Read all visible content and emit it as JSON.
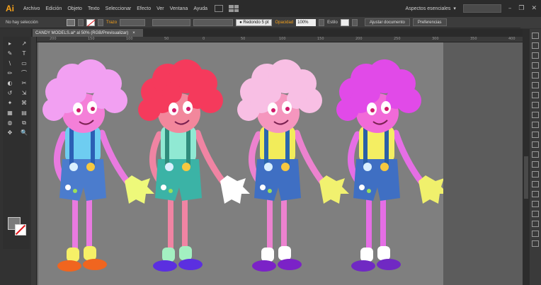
{
  "app": {
    "logo": "Ai",
    "workspace": "Aspectos esenciales",
    "window_controls": [
      "–",
      "❐",
      "✕"
    ]
  },
  "menu": [
    "Archivo",
    "Edición",
    "Objeto",
    "Texto",
    "Seleccionar",
    "Efecto",
    "Ver",
    "Ventana",
    "Ayuda"
  ],
  "control": {
    "selection": "No hay selección",
    "stroke_label": "Trazo",
    "brush": "Redondo 5 pt",
    "opacity_label": "Opacidad",
    "opacity_value": "100%",
    "style_label": "Estilo",
    "doc_setup": "Ajustar documento",
    "preferences": "Preferencias"
  },
  "document": {
    "tab_title": "CANDY MODELS.ai* al 50% (RGB/Previsualizar)",
    "close": "×"
  },
  "ruler": {
    "marks": [
      "200",
      "150",
      "100",
      "50",
      "0",
      "50",
      "100",
      "150",
      "200",
      "250",
      "300",
      "350",
      "400"
    ]
  },
  "tools": [
    "▸",
    "↗",
    "✎",
    "T",
    "\\",
    "▭",
    "✏",
    "⌒",
    "◐",
    "✂",
    "↺",
    "⇲",
    "✦",
    "⌘",
    "▦",
    "▤",
    "◍",
    "⧉",
    "✥",
    "🔍"
  ],
  "colors": {
    "accent": "#f7a21b",
    "artboard": "#7f7f7f",
    "pasteboard": "#5c5c5c"
  },
  "characters": [
    {
      "name": "clown-1",
      "hair": "#f2a0f2",
      "skin": "#f47fd8",
      "limb": "#e97ae0",
      "shirt": "#6ecdf1",
      "suspender": "#2b5fb5",
      "shorts": "#4b7ccd",
      "glove": "#eef97a",
      "sock": "#f6f067",
      "shoe": "#f0651f"
    },
    {
      "name": "clown-2",
      "hair": "#f53a5c",
      "skin": "#f2879c",
      "limb": "#f084a3",
      "shirt": "#90e9d3",
      "suspender": "#2f8c7c",
      "shorts": "#3bb3a6",
      "glove": "#ffffff",
      "sock": "#a3f0c1",
      "shoe": "#5b2fe0"
    },
    {
      "name": "clown-3",
      "hair": "#f8bfe4",
      "skin": "#f596be",
      "limb": "#ec82cf",
      "shirt": "#f2ec5a",
      "suspender": "#2a66ad",
      "shorts": "#3f6fc3",
      "glove": "#f1f16f",
      "sock": "#ffffff",
      "shoe": "#7b22c7"
    },
    {
      "name": "clown-4",
      "hair": "#e14ae8",
      "skin": "#f16ad8",
      "limb": "#e56ee5",
      "shirt": "#f4ee62",
      "suspender": "#2a5fa6",
      "shorts": "#3f6fc3",
      "glove": "#f0f06c",
      "sock": "#ffffff",
      "shoe": "#7029c3"
    }
  ]
}
